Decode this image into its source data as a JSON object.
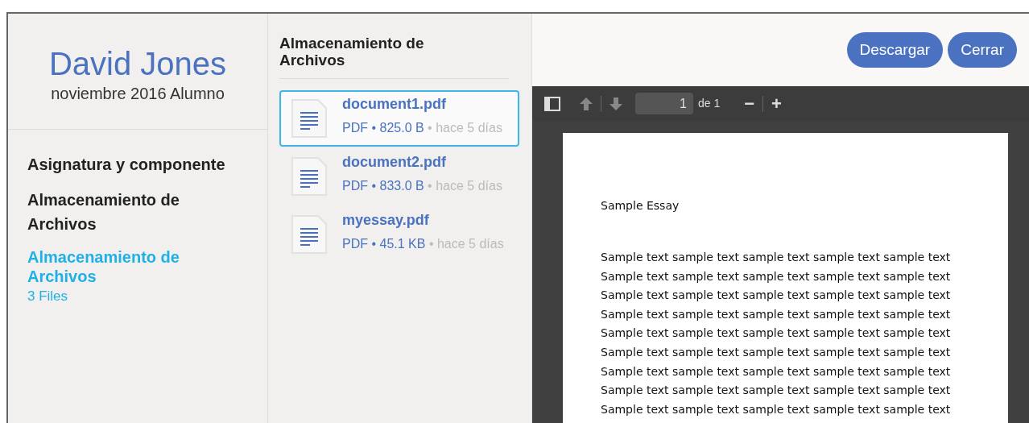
{
  "profile": {
    "name": "David Jones",
    "subtitle": "noviembre 2016 Alumno"
  },
  "nav": [
    {
      "label": "Asignatura y componente",
      "selected": false
    },
    {
      "label": "Almacenamiento de Archivos",
      "selected": false
    },
    {
      "label": "Almacenamiento de Archivos",
      "selected": true,
      "count": "3 Files"
    }
  ],
  "files_panel": {
    "title": "Almacenamiento de Archivos",
    "files": [
      {
        "name": "document1.pdf",
        "meta": "PDF • 825.0 B",
        "age": "• hace 5 días",
        "selected": true
      },
      {
        "name": "document2.pdf",
        "meta": "PDF • 833.0 B",
        "age": "• hace 5 días",
        "selected": false
      },
      {
        "name": "myessay.pdf",
        "meta": "PDF • 45.1 KB",
        "age": "• hace 5 días",
        "selected": false
      }
    ]
  },
  "buttons": [
    "Descargar",
    "Cerrar"
  ],
  "viewer": {
    "page_number": "1",
    "page_total": "de 1",
    "zoom_out": "−",
    "zoom_in": "+",
    "document": {
      "title": "Sample Essay",
      "lines": [
        "Sample text sample text sample text sample text sample text",
        "Sample text sample text sample text sample text sample text",
        "Sample text sample text sample text sample text sample text",
        "Sample text sample text sample text sample text sample text",
        "Sample text sample text sample text sample text sample text",
        "Sample text sample text sample text sample text sample text",
        "Sample text sample text sample text sample text sample text",
        "Sample text sample text sample text sample text sample text",
        "Sample text sample text sample text sample text sample text"
      ]
    }
  }
}
